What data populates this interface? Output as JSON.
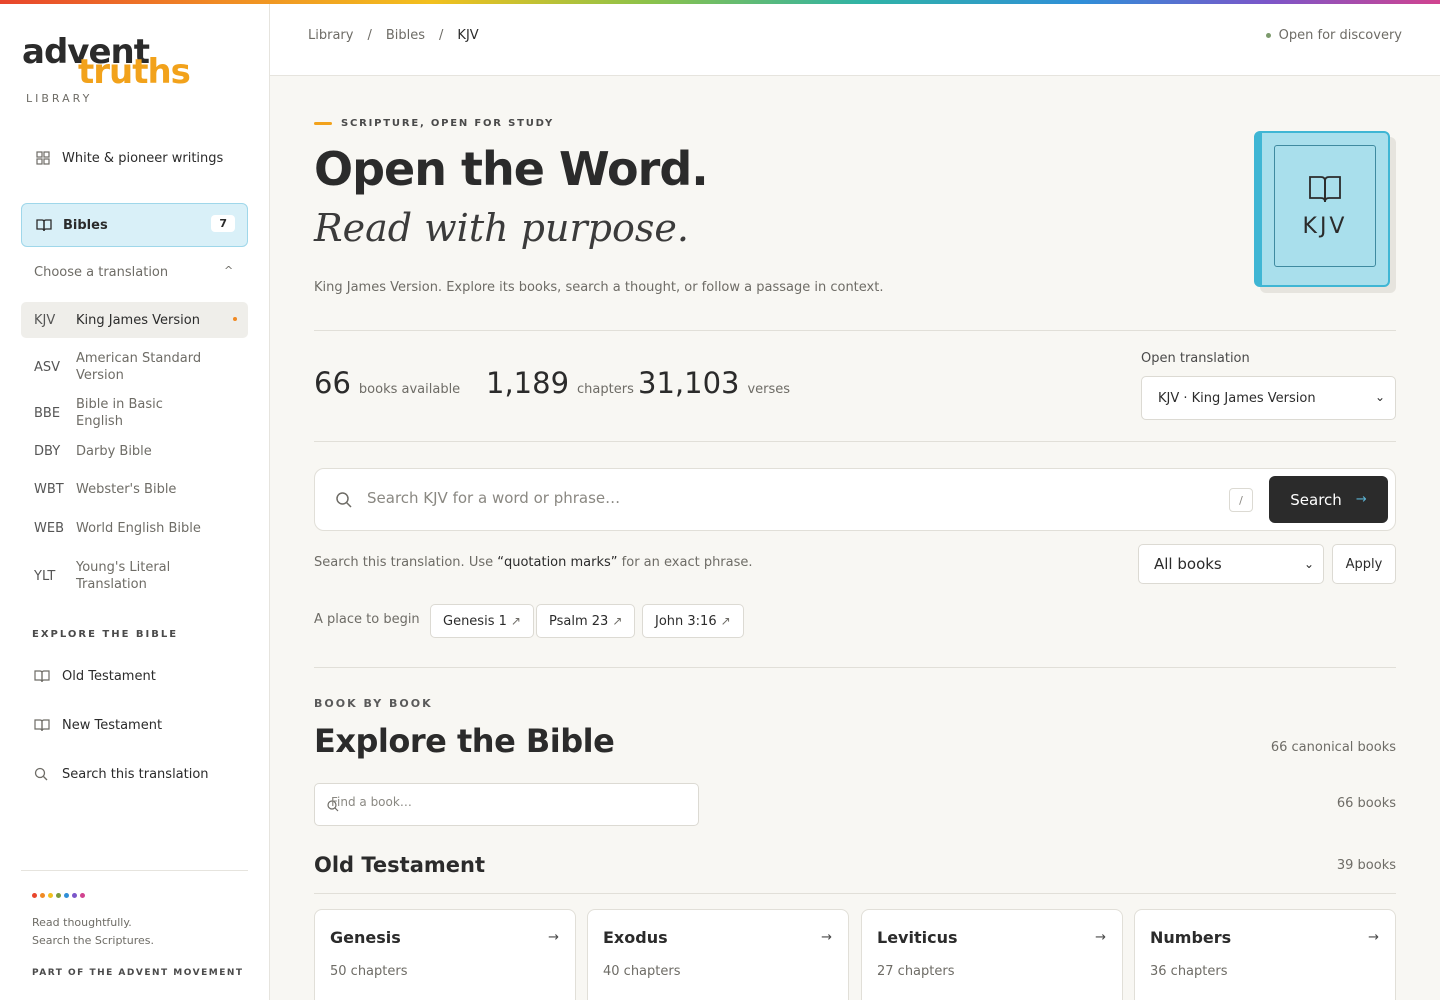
{
  "sidebar": {
    "logo_line1": "advent",
    "logo_line2": "truths",
    "logo_sub": "LIBRARY",
    "writings_label": "White & pioneer writings",
    "bibles_label": "Bibles",
    "bibles_count": "7",
    "choose_label": "Choose a translation",
    "translations": [
      {
        "abbr": "KJV",
        "name": "King James Version"
      },
      {
        "abbr": "ASV",
        "name": "American Standard Version"
      },
      {
        "abbr": "BBE",
        "name": "Bible in Basic English"
      },
      {
        "abbr": "DBY",
        "name": "Darby Bible"
      },
      {
        "abbr": "WBT",
        "name": "Webster's Bible"
      },
      {
        "abbr": "WEB",
        "name": "World English Bible"
      },
      {
        "abbr": "YLT",
        "name": "Young's Literal Translation"
      }
    ],
    "explore_label": "EXPLORE THE BIBLE",
    "old_testament": "Old Testament",
    "new_testament": "New Testament",
    "search_translation": "Search this translation",
    "footer_line1": "Read thoughtfully.",
    "footer_line2": "Search the Scriptures.",
    "footer_movement": "PART OF THE ADVENT MOVEMENT",
    "dot_colors": [
      "#e8452c",
      "#f08a24",
      "#f2c01e",
      "#7c9a3c",
      "#2f8fd8",
      "#7b56c9",
      "#d1438f"
    ]
  },
  "topbar": {
    "crumbs": [
      "Library",
      "/",
      "Bibles",
      "/",
      "KJV"
    ],
    "status": "Open for discovery"
  },
  "hero": {
    "eyebrow": "SCRIPTURE, OPEN FOR STUDY",
    "title": "Open the Word.",
    "subtitle": "Read with purpose.",
    "lede": "King James Version. Explore its books, search a thought, or follow a passage in context.",
    "book_abbr": "KJV"
  },
  "stats": [
    {
      "num": "66",
      "label": "books available"
    },
    {
      "num": "1,189",
      "label": "chapters"
    },
    {
      "num": "31,103",
      "label": "verses"
    }
  ],
  "open_translation": {
    "label": "Open translation",
    "value": "KJV · King James Version"
  },
  "search": {
    "placeholder": "Search KJV for a word or phrase…",
    "kbd": "/",
    "button": "Search",
    "hint_pre": "Search this translation. Use ",
    "hint_quote": "“quotation marks”",
    "hint_post": " for an exact phrase.",
    "filter_value": "All books",
    "apply": "Apply"
  },
  "begin": {
    "label": "A place to begin",
    "chips": [
      "Genesis 1",
      "Psalm 23",
      "John 3:16"
    ]
  },
  "explore": {
    "eyebrow": "BOOK BY BOOK",
    "title": "Explore the Bible",
    "canonical": "66 canonical books",
    "find_placeholder": "Find a book…",
    "book_count": "66 books"
  },
  "old_testament": {
    "title": "Old Testament",
    "count": "39 books",
    "books": [
      {
        "name": "Genesis",
        "chapters": "50 chapters"
      },
      {
        "name": "Exodus",
        "chapters": "40 chapters"
      },
      {
        "name": "Leviticus",
        "chapters": "27 chapters"
      },
      {
        "name": "Numbers",
        "chapters": "36 chapters"
      }
    ]
  }
}
